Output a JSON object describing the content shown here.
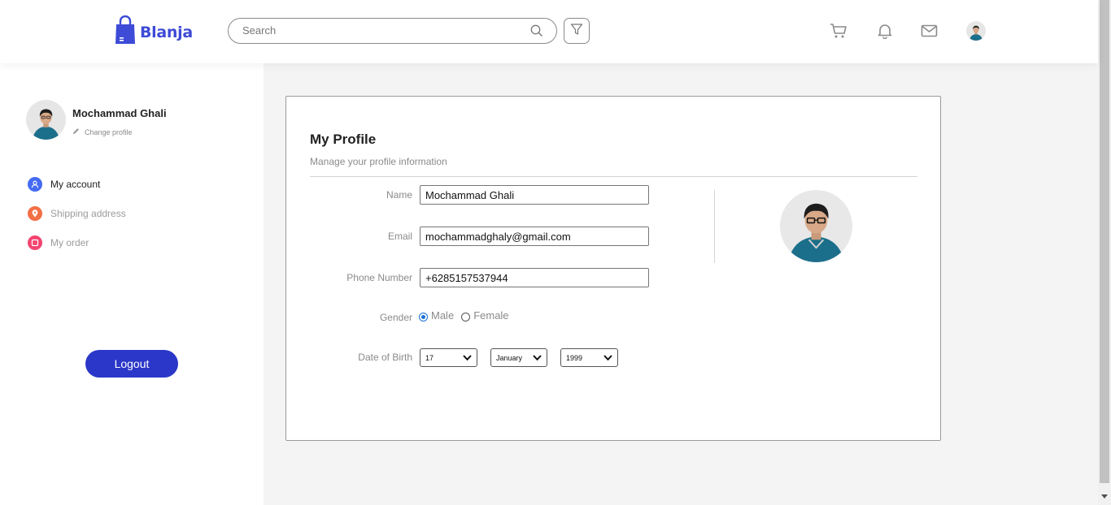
{
  "header": {
    "logo_text": "Blanja",
    "search_placeholder": "Search",
    "icons": [
      "cart-icon",
      "bell-icon",
      "mail-icon",
      "avatar"
    ]
  },
  "sidebar": {
    "user_name": "Mochammad Ghali",
    "change_profile": "Change profile",
    "items": [
      {
        "label": "My account",
        "icon": "user-icon",
        "color": "#456bf3",
        "active": true
      },
      {
        "label": "Shipping address",
        "icon": "map-pin-icon",
        "color": "#f36f45",
        "active": false
      },
      {
        "label": "My order",
        "icon": "clipboard-icon",
        "color": "#f3456f",
        "active": false
      }
    ],
    "logout_label": "Logout"
  },
  "profile": {
    "title": "My Profile",
    "subtitle": "Manage your profile information",
    "name_label": "Name",
    "name_value": "Mochammad Ghali",
    "email_label": "Email",
    "email_value": "mochammadghaly@gmail.com",
    "phone_label": "Phone Number",
    "phone_value": "+6285157537944",
    "gender_label": "Gender",
    "gender_options": [
      "Male",
      "Female"
    ],
    "gender_selected": "Male",
    "dob_label": "Date of Birth",
    "dob_day": "17",
    "dob_month": "January",
    "dob_year": "1999"
  },
  "colors": {
    "brand": "#3d4bd6",
    "logout_bg": "#2b37c8",
    "radio_checked": "#1a6fd4"
  }
}
